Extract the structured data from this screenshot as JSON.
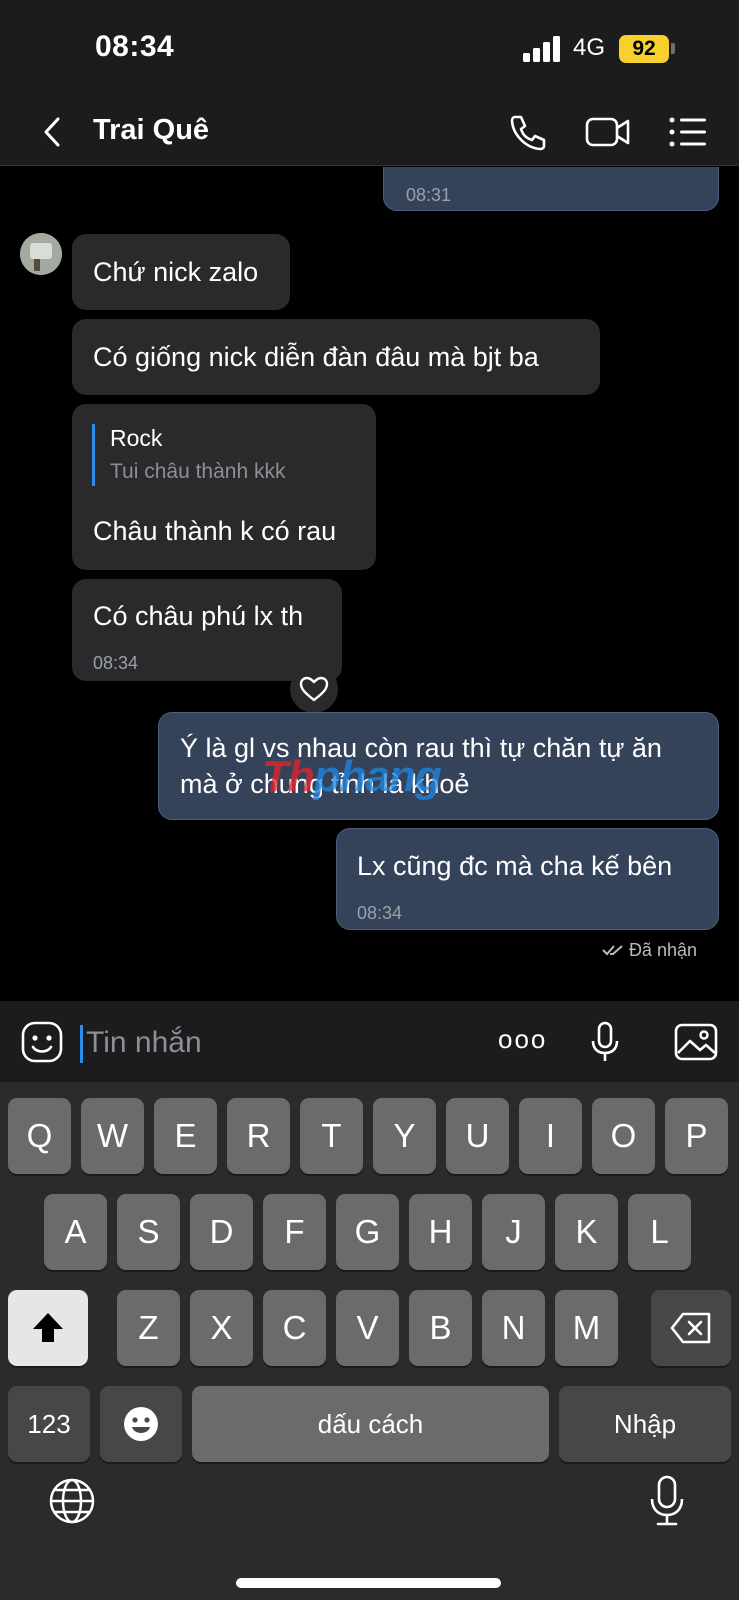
{
  "status": {
    "time": "08:34",
    "network": "4G",
    "battery": "92"
  },
  "header": {
    "contact_name": "Trai Quê"
  },
  "messages": {
    "m0_time": "08:31",
    "m1": "Chứ nick zalo",
    "m2": "Có giống nick diễn đàn đâu mà bjt ba",
    "m3_quote_name": "Rock",
    "m3_quote_text": "Tui châu thành kkk",
    "m3": "Châu thành k có rau",
    "m4": "Có châu phú lx th",
    "m4_time": "08:34",
    "m5_line1": "Ý là gl vs nhau còn rau thì tự chăn tự ăn",
    "m5_line2": "mà ở chung tỉnh là khoẻ",
    "m6": "Lx cũng đc mà cha kế bên",
    "m6_time": "08:34",
    "read_receipt": "Đã nhận"
  },
  "watermark": {
    "part1": "Th",
    "part2": "phang"
  },
  "input": {
    "placeholder": "Tin nhắn",
    "more": "ooo"
  },
  "keyboard": {
    "row1": [
      "Q",
      "W",
      "E",
      "R",
      "T",
      "Y",
      "U",
      "I",
      "O",
      "P"
    ],
    "row2": [
      "A",
      "S",
      "D",
      "F",
      "G",
      "H",
      "J",
      "K",
      "L"
    ],
    "row3": [
      "Z",
      "X",
      "C",
      "V",
      "B",
      "N",
      "M"
    ],
    "num_key": "123",
    "space_key": "dấu cách",
    "enter_key": "Nhập"
  },
  "icons": {
    "back": "chevron-left-icon",
    "call": "phone-icon",
    "video": "video-camera-icon",
    "menu": "list-menu-icon",
    "sticker": "sticker-face-icon",
    "mic": "microphone-icon",
    "image": "image-icon",
    "shift": "shift-arrow-icon",
    "delete": "backspace-icon",
    "emoji": "emoji-icon",
    "globe": "globe-icon"
  }
}
